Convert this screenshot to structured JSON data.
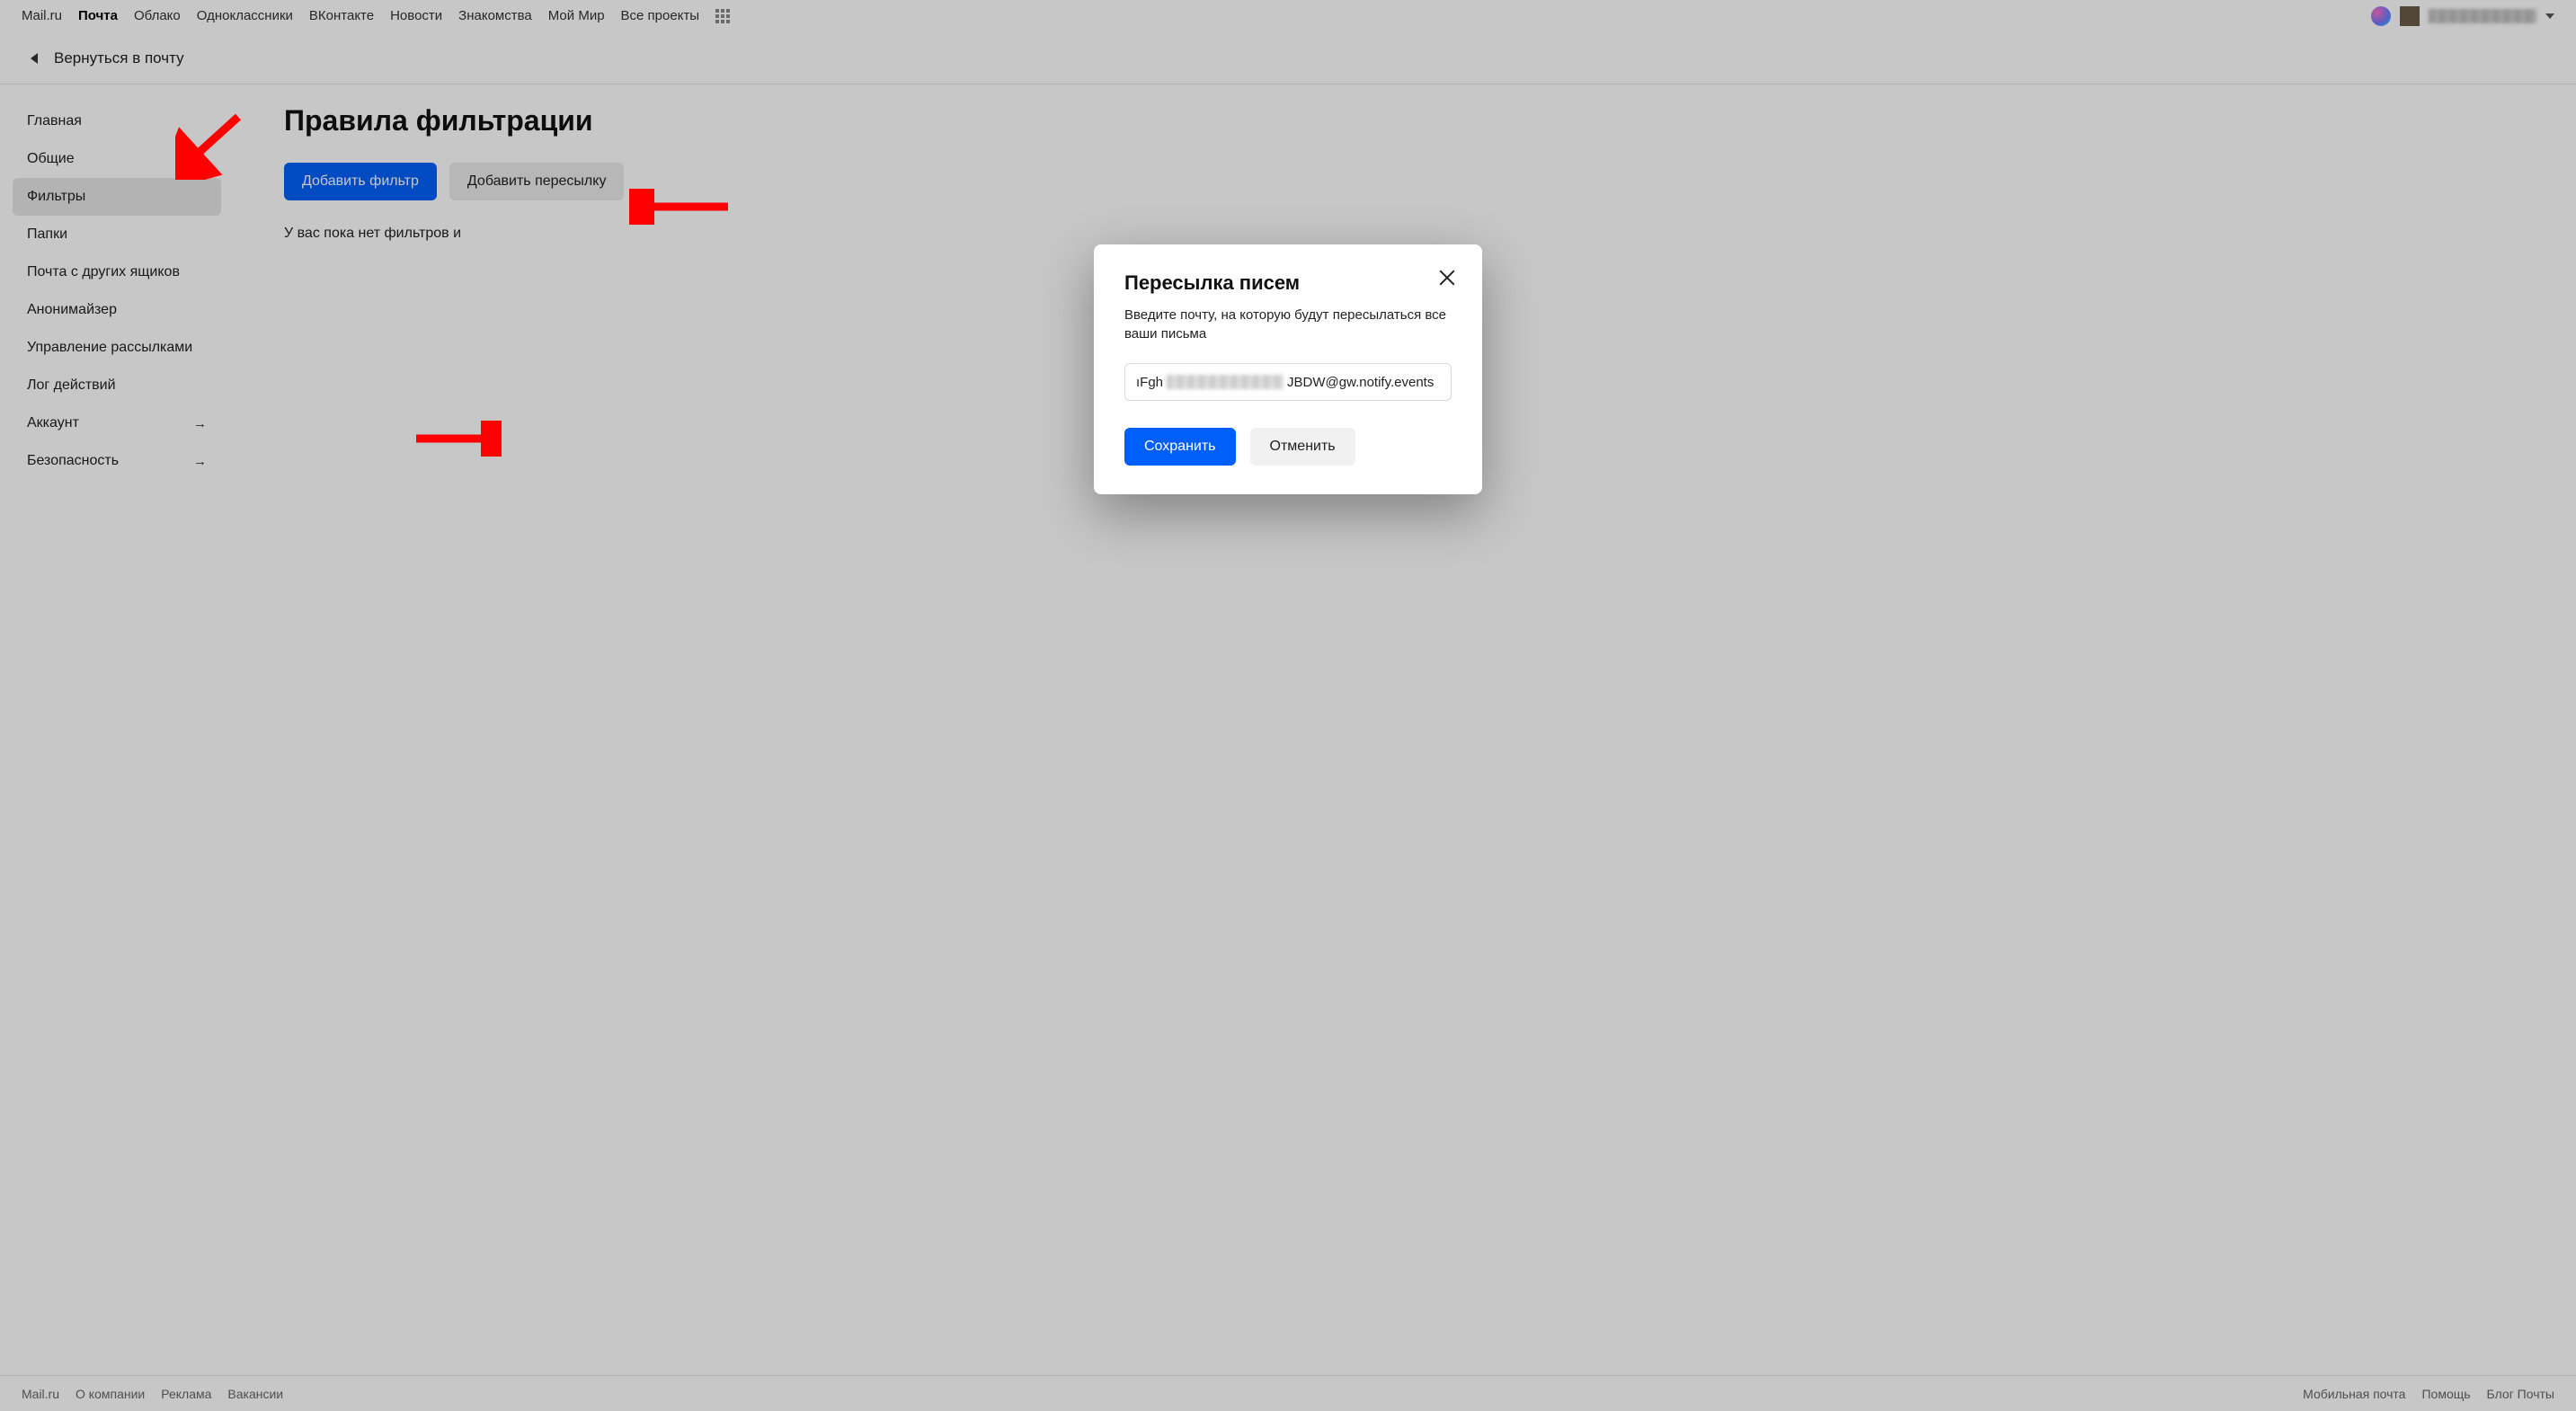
{
  "topbar": {
    "links": [
      "Mail.ru",
      "Почта",
      "Облако",
      "Одноклассники",
      "ВКонтакте",
      "Новости",
      "Знакомства",
      "Мой Мир",
      "Все проекты"
    ],
    "active_index": 1
  },
  "backrow": {
    "label": "Вернуться в почту"
  },
  "sidebar": {
    "items": [
      {
        "label": "Главная",
        "arrow": false
      },
      {
        "label": "Общие",
        "arrow": false
      },
      {
        "label": "Фильтры",
        "arrow": false,
        "active": true
      },
      {
        "label": "Папки",
        "arrow": false
      },
      {
        "label": "Почта с других ящиков",
        "arrow": false
      },
      {
        "label": "Анонимайзер",
        "arrow": false
      },
      {
        "label": "Управление рассылками",
        "arrow": false
      },
      {
        "label": "Лог действий",
        "arrow": false
      },
      {
        "label": "Аккаунт",
        "arrow": true
      },
      {
        "label": "Безопасность",
        "arrow": true
      }
    ]
  },
  "main": {
    "title": "Правила фильтрации",
    "add_filter": "Добавить фильтр",
    "add_forward": "Добавить пересылку",
    "empty": "У вас пока нет фильтров и"
  },
  "modal": {
    "title": "Пересылка писем",
    "desc": "Введите почту, на которую будут пересылаться все ваши письма",
    "input_prefix": "ıFgh",
    "input_suffix": "JBDW@gw.notify.events",
    "save": "Сохранить",
    "cancel": "Отменить"
  },
  "footer": {
    "left": [
      "Mail.ru",
      "О компании",
      "Реклама",
      "Вакансии"
    ],
    "right": [
      "Мобильная почта",
      "Помощь",
      "Блог Почты"
    ]
  }
}
